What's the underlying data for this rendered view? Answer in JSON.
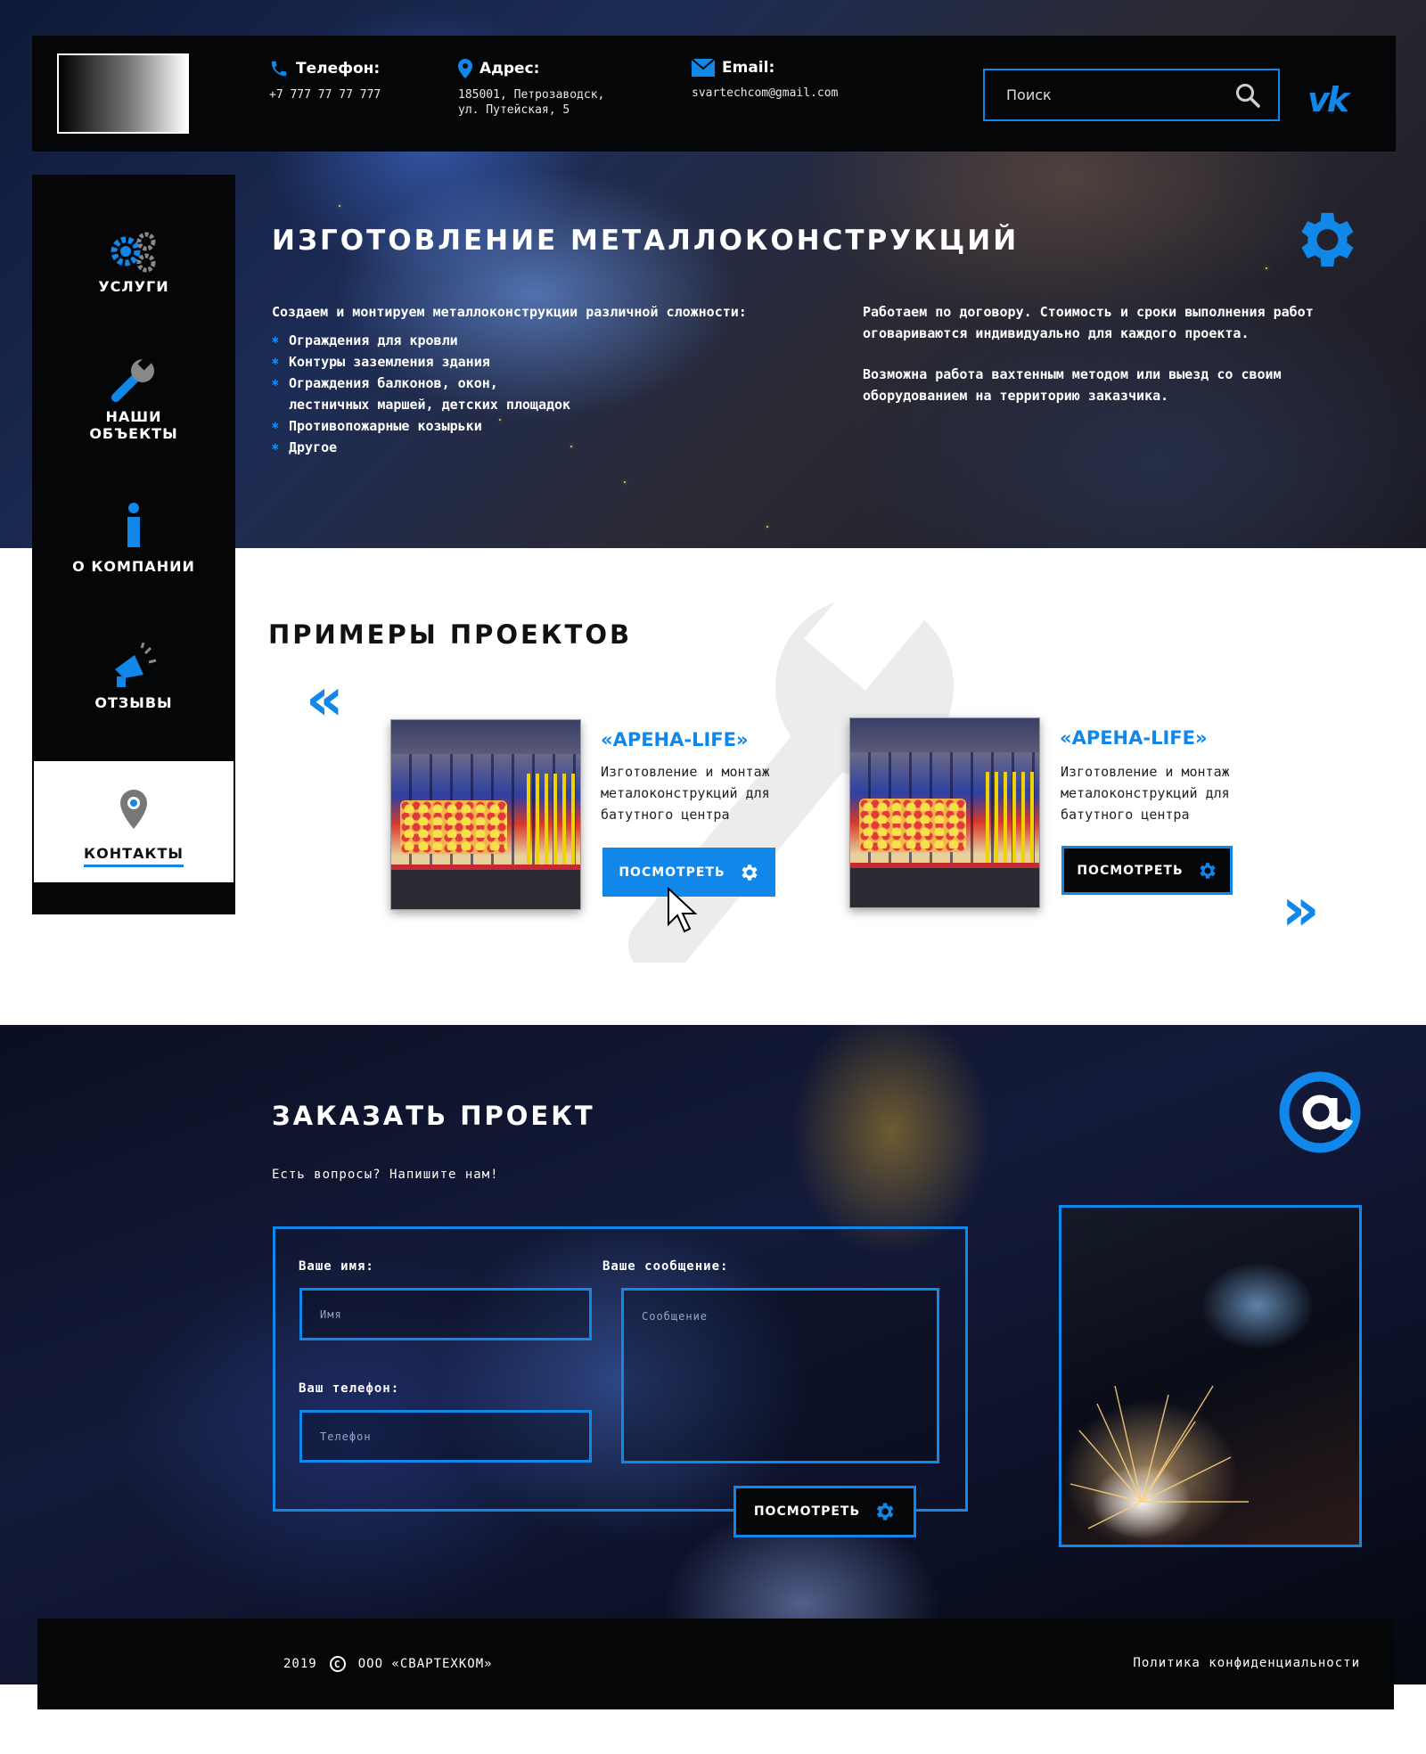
{
  "header": {
    "phone": {
      "title": "Телефон:",
      "value": "+7 777 77 77 777"
    },
    "address": {
      "title": "Адрес:",
      "line1": "185001, Петрозаводск,",
      "line2": "ул. Путейская, 5"
    },
    "email": {
      "title": "Email:",
      "value": "svartechcom@gmail.com"
    },
    "search_placeholder": "Поиск",
    "social_label": "vk"
  },
  "sidebar": {
    "items": [
      {
        "label": "УСЛУГИ",
        "icon": "gears-icon"
      },
      {
        "label1": "НАШИ",
        "label2": "ОБЪЕКТЫ",
        "icon": "wrench-icon"
      },
      {
        "label": "О КОМПАНИИ",
        "icon": "info-icon"
      },
      {
        "label": "ОТЗЫВЫ",
        "icon": "megaphone-icon"
      },
      {
        "label": "КОНТАКТЫ",
        "icon": "location-pin-icon",
        "active": true
      }
    ]
  },
  "hero": {
    "title": "ИЗГОТОВЛЕНИЕ МЕТАЛЛОКОНСТРУКЦИЙ",
    "intro": "Создаем и монтируем металлоконструкции различной сложности:",
    "list": [
      "Ограждения для кровли",
      "Контуры заземления здания",
      "Ограждения балконов, окон,",
      "лестничных маршей, детских площадок",
      "Противопожарные козырьки",
      "Другое"
    ],
    "right_p1": "Работаем по договору. Стоимость и сроки выполнения работ оговариваются индивидуально для каждого проекта.",
    "right_p2": "Возможна работа вахтенным методом или выезд со своим оборудованием на территорию заказчика."
  },
  "projects": {
    "title": "ПРИМЕРЫ ПРОЕКТОВ",
    "prev_arrow": "«",
    "next_arrow": "»",
    "cards": [
      {
        "name": "«АРЕНА-LIFE»",
        "desc": "Изготовление и монтаж металоконструкций для батутного центра",
        "button": "ПОСМОТРЕТЬ"
      },
      {
        "name": "«АРЕНА-LIFE»",
        "desc": "Изготовление и монтаж металоконструкций для батутного центра",
        "button": "ПОСМОТРЕТЬ"
      }
    ]
  },
  "order": {
    "title": "ЗАКАЗАТЬ ПРОЕКТ",
    "subtitle": "Есть вопросы? Напишите нам!",
    "name_label": "Ваше имя:",
    "name_placeholder": "Имя",
    "phone_label": "Ваш телефон:",
    "phone_placeholder": "Телефон",
    "message_label": "Ваше сообщение:",
    "message_placeholder": "Сообщение",
    "submit": "ПОСМОТРЕТЬ"
  },
  "footer": {
    "year": "2019",
    "company": "ООО «СВАРТЕХКОМ»",
    "privacy": "Политика конфиденциальности"
  },
  "colors": {
    "accent": "#1187ea",
    "dark": "#050608"
  }
}
